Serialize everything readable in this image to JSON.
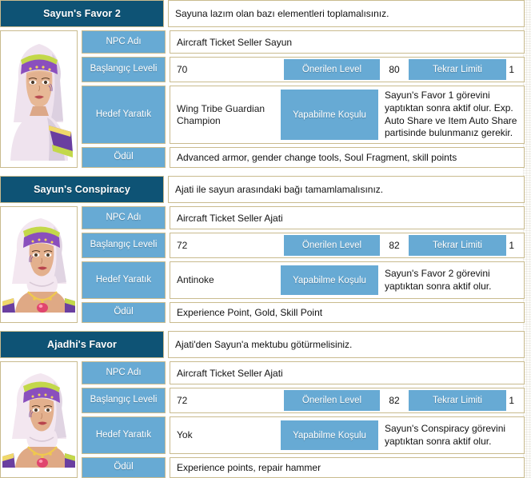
{
  "colors": {
    "header_bg": "#0e5375",
    "label_blue": "#67aad4",
    "border_tan": "#c9bb8e",
    "page_bg": "#ffffff",
    "text": "#111111"
  },
  "labels": {
    "npc": "NPC Adı",
    "start_level": "Başlangıç Leveli",
    "recommended_level": "Önerilen Level",
    "repeat_limit": "Tekrar Limiti",
    "target_mob": "Hedef Yaratık",
    "condition": "Yapabilme Koşulu",
    "reward": "Ödül"
  },
  "quests": [
    {
      "title": "Sayun's Favor 2",
      "description": "Sayuna lazım olan bazı elementleri toplamalısınız.",
      "portrait_name": "sayun-portrait",
      "npc": "Aircraft Ticket Seller Sayun",
      "start_level": "70",
      "recommended_level": "80",
      "repeat_limit": "1",
      "target_mob": "Wing Tribe Guardian Champion",
      "condition": "Sayun's Favor 1 görevini yaptıktan sonra aktif olur. Exp. Auto Share ve Item Auto Share partisinde bulunmanız gerekir.",
      "reward": "Advanced armor, gender change tools, Soul Fragment, skill points"
    },
    {
      "title": "Sayun's Conspiracy",
      "description": "Ajati ile sayun arasındaki bağı tamamlamalısınız.",
      "portrait_name": "ajati-portrait",
      "npc": "Aircraft Ticket Seller Ajati",
      "start_level": "72",
      "recommended_level": "82",
      "repeat_limit": "1",
      "target_mob": "Antinoke",
      "condition": "Sayun's Favor 2 görevini yaptıktan sonra aktif olur.",
      "reward": "Experience Point, Gold, Skill Point"
    },
    {
      "title": "Ajadhi's Favor",
      "description": "Ajati'den Sayun'a mektubu götürmelisiniz.",
      "portrait_name": "ajati-portrait",
      "npc": "Aircraft Ticket Seller Ajati",
      "start_level": "72",
      "recommended_level": "82",
      "repeat_limit": "1",
      "target_mob": "Yok",
      "condition": "Sayun's Conspiracy görevini yaptıktan sonra aktif olur.",
      "reward": "Experience points, repair hammer"
    }
  ]
}
